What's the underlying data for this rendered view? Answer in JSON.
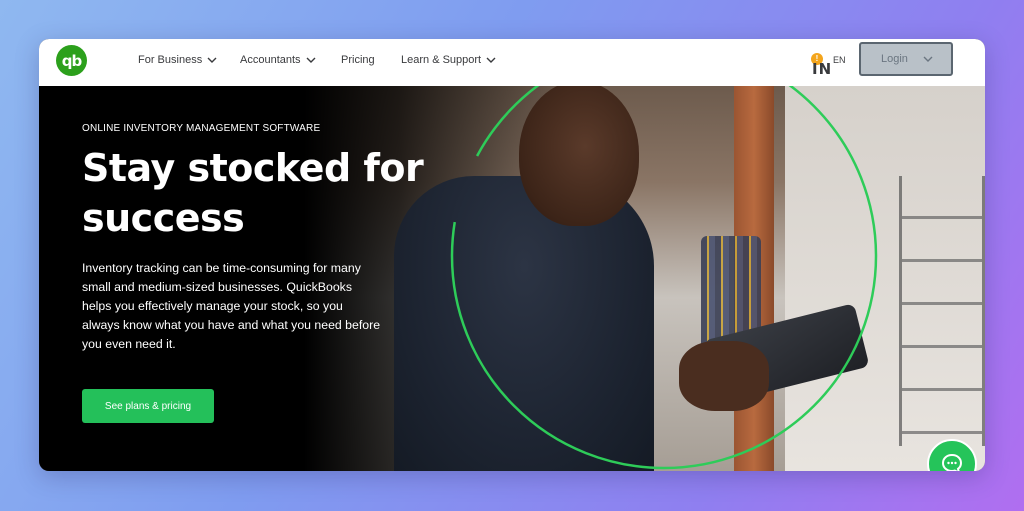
{
  "brand": {
    "logo_text": "qb",
    "color": "#2ca01c"
  },
  "nav": {
    "items": [
      {
        "label": "For Business",
        "has_dropdown": true
      },
      {
        "label": "Accountants",
        "has_dropdown": true
      },
      {
        "label": "Pricing",
        "has_dropdown": false
      },
      {
        "label": "Learn & Support",
        "has_dropdown": true
      }
    ],
    "region": {
      "badge": "!",
      "flag_text": "IN",
      "lang": "EN"
    },
    "login_label": "Login"
  },
  "hero": {
    "eyebrow": "ONLINE INVENTORY MANAGEMENT SOFTWARE",
    "headline": "Stay stocked  for success",
    "description": "Inventory tracking can be time-consuming for many small and medium-sized businesses. QuickBooks helps you effectively manage your stock, so you always know what you have and what you need before you even need it.",
    "cta_label": "See plans & pricing",
    "accent_color": "#24c05a"
  },
  "chat": {
    "icon": "chat-bubble-icon"
  }
}
